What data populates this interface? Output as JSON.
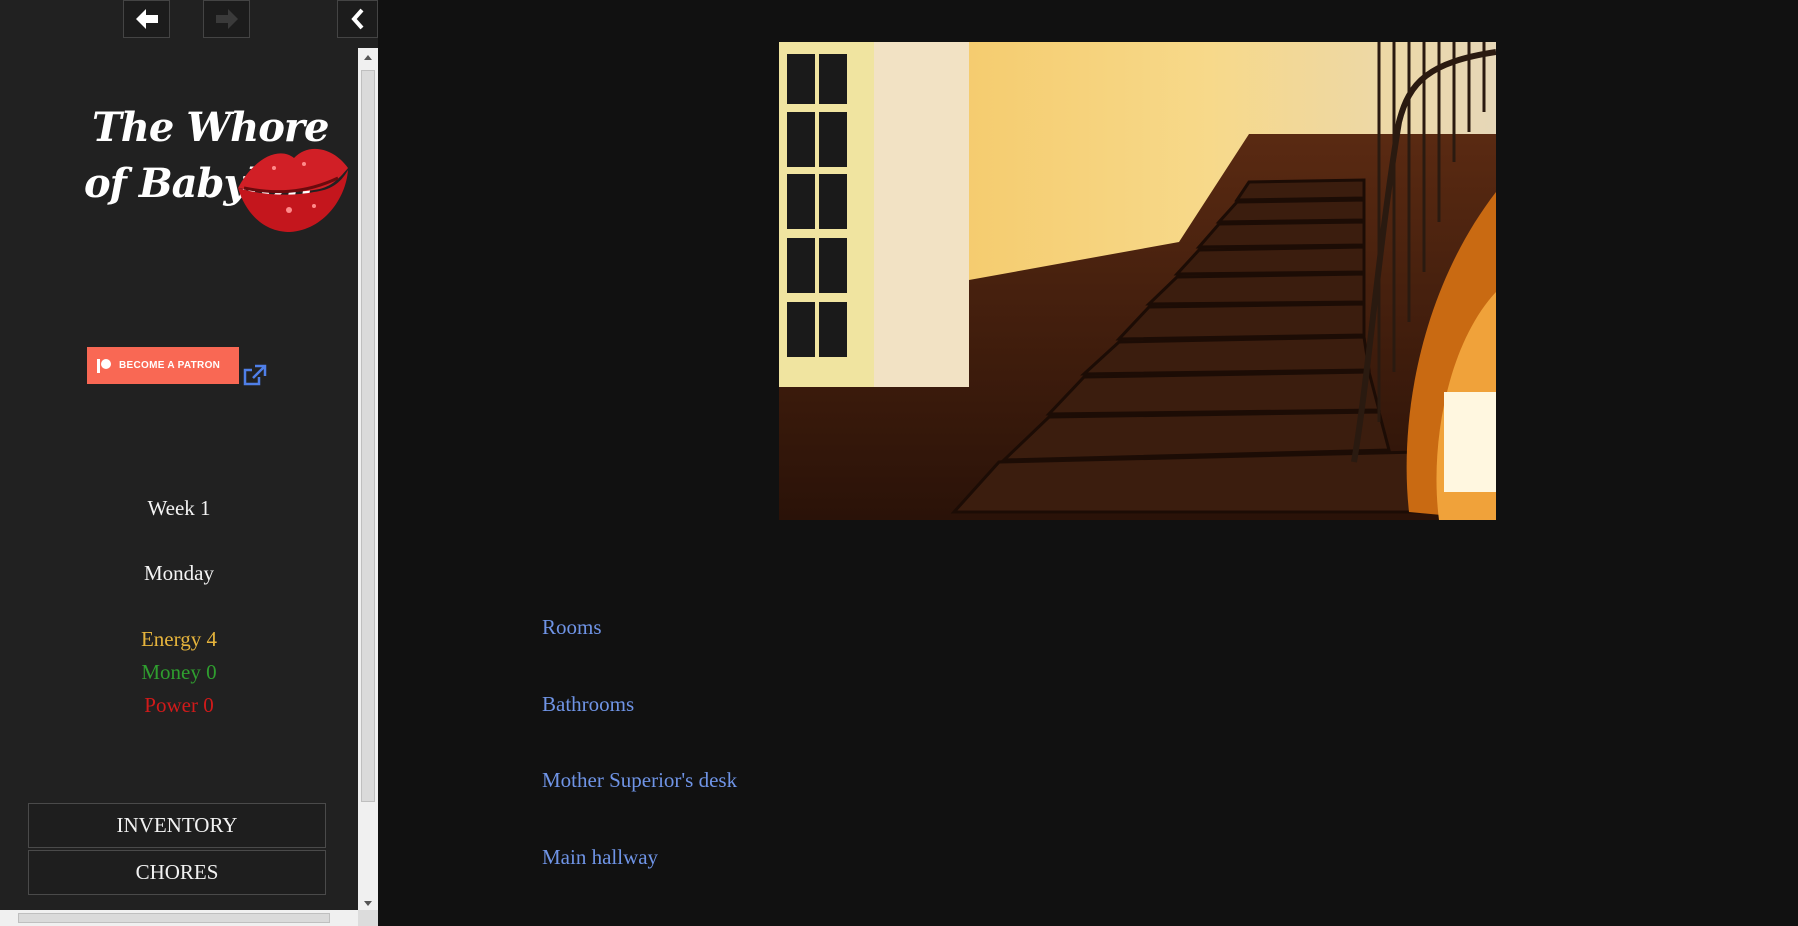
{
  "nav": {
    "back_icon": "arrow-left-icon",
    "forward_icon": "arrow-right-icon",
    "collapse_icon": "chevron-left-icon"
  },
  "logo": {
    "line1": "The Whore",
    "line2": "of Babylon"
  },
  "patron": {
    "label": "BECOME A PATRON",
    "icon": "patreon-icon",
    "external_icon": "external-link-icon"
  },
  "stats": {
    "week": "Week 1",
    "day": "Monday",
    "energy": "Energy 4",
    "money": "Money 0",
    "power": "Power 0"
  },
  "colors": {
    "energy": "#e6b43c",
    "money": "#2f9e2f",
    "power": "#d11a1a",
    "link": "#6f94e6",
    "patron": "#f96854"
  },
  "menu": {
    "inventory": "INVENTORY",
    "chores": "CHORES"
  },
  "links": [
    "Rooms",
    "Bathrooms",
    "Mother Superior's desk",
    "Main hallway"
  ]
}
